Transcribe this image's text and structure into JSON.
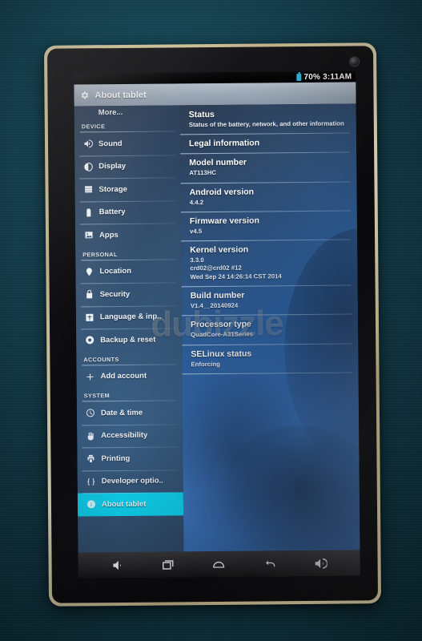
{
  "statusbar": {
    "battery_icon": "battery-icon",
    "battery_text": "70%",
    "time": "3:11AM"
  },
  "actionbar": {
    "icon": "gear-icon",
    "title": "About tablet"
  },
  "sidebar": {
    "more_label": "More...",
    "sections": [
      {
        "header": "DEVICE",
        "items": [
          {
            "label": "Sound",
            "icon": "sound-icon",
            "selected": false
          },
          {
            "label": "Display",
            "icon": "display-icon",
            "selected": false
          },
          {
            "label": "Storage",
            "icon": "storage-icon",
            "selected": false
          },
          {
            "label": "Battery",
            "icon": "battery-icon",
            "selected": false
          },
          {
            "label": "Apps",
            "icon": "apps-icon",
            "selected": false
          }
        ]
      },
      {
        "header": "PERSONAL",
        "items": [
          {
            "label": "Location",
            "icon": "location-pin-icon",
            "selected": false
          },
          {
            "label": "Security",
            "icon": "lock-icon",
            "selected": false
          },
          {
            "label": "Language & inp..",
            "icon": "language-icon",
            "selected": false
          },
          {
            "label": "Backup & reset",
            "icon": "backup-reset-icon",
            "selected": false
          }
        ]
      },
      {
        "header": "ACCOUNTS",
        "items": [
          {
            "label": "Add account",
            "icon": "plus-icon",
            "selected": false
          }
        ]
      },
      {
        "header": "SYSTEM",
        "items": [
          {
            "label": "Date & time",
            "icon": "clock-icon",
            "selected": false
          },
          {
            "label": "Accessibility",
            "icon": "accessibility-icon",
            "selected": false
          },
          {
            "label": "Printing",
            "icon": "printer-icon",
            "selected": false
          },
          {
            "label": "Developer optio..",
            "icon": "braces-icon",
            "selected": false
          },
          {
            "label": "About tablet",
            "icon": "info-icon",
            "selected": true
          }
        ]
      }
    ]
  },
  "pane": {
    "rows": [
      {
        "title": "Status",
        "sub": "Status of the battery, network, and other information"
      },
      {
        "title": "Legal information",
        "sub": ""
      },
      {
        "title": "Model number",
        "sub": "AT113HC"
      },
      {
        "title": "Android version",
        "sub": "4.4.2"
      },
      {
        "title": "Firmware version",
        "sub": "v4.5"
      },
      {
        "title": "Kernel version",
        "sub": "3.3.0\ncrd02@crd02 #12\nWed Sep 24 14:26:14 CST 2014"
      },
      {
        "title": "Build number",
        "sub": "V1.4__20140924"
      },
      {
        "title": "Processor type",
        "sub": "QuadCore-A31Series"
      },
      {
        "title": "SELinux status",
        "sub": "Enforcing"
      }
    ]
  },
  "navbar": {
    "buttons": [
      {
        "icon": "volume-down-icon"
      },
      {
        "icon": "recents-icon"
      },
      {
        "icon": "home-icon"
      },
      {
        "icon": "back-icon"
      },
      {
        "icon": "volume-up-icon"
      }
    ]
  },
  "watermark": {
    "text": "dubizzle"
  },
  "colors": {
    "accent_selected": "#0fd2ef",
    "status_accent": "#33b5e5",
    "background_fabric": "#14414f",
    "bezel_gold": "#d8cca4"
  }
}
